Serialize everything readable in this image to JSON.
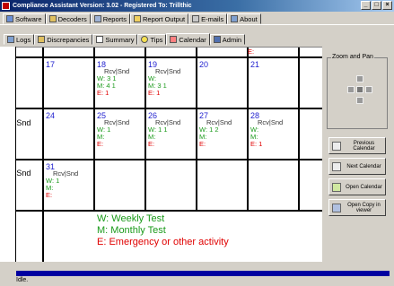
{
  "window": {
    "title": "Compliance Assistant Version: 3.02 - Registered To: Trillthic"
  },
  "menu_tabs": [
    "Software",
    "Decoders",
    "Reports",
    "Report Output",
    "E-mails",
    "About"
  ],
  "sub_tabs": [
    "Logs",
    "Discrepancies",
    "Summary",
    "Tips",
    "Calendar",
    "Admin"
  ],
  "active_sub_tab": "Calendar",
  "calendar": {
    "top_fragment": "E:",
    "left_fragments": [
      "|Snd",
      "|Snd"
    ],
    "days": [
      {
        "day": "17",
        "header": "",
        "w": "",
        "m": "",
        "e": ""
      },
      {
        "day": "18",
        "header": "Rcv|Snd",
        "w": "W:  3   1",
        "m": "M:  4   1",
        "e": "E:          1"
      },
      {
        "day": "19",
        "header": "Rcv|Snd",
        "w": "W:",
        "m": "M:  3   1",
        "e": "E:  1"
      },
      {
        "day": "20",
        "header": "",
        "w": "",
        "m": "",
        "e": ""
      },
      {
        "day": "21",
        "header": "",
        "w": "",
        "m": "",
        "e": ""
      },
      {
        "day": "24",
        "header": "",
        "w": "",
        "m": "",
        "e": ""
      },
      {
        "day": "25",
        "header": "Rcv|Snd",
        "w": "W:  1",
        "m": "M:",
        "e": "E:"
      },
      {
        "day": "26",
        "header": "Rcv|Snd",
        "w": "W:  1   1",
        "m": "M:",
        "e": "E:"
      },
      {
        "day": "27",
        "header": "Rcv|Snd",
        "w": "W:  1   2",
        "m": "M:",
        "e": "E:"
      },
      {
        "day": "28",
        "header": "Rcv|Snd",
        "w": "W:",
        "m": "M:",
        "e": "E:   1"
      },
      {
        "day": "31",
        "header": "Rcv|Snd",
        "w": "W:  1",
        "m": "M:",
        "e": "E:"
      }
    ]
  },
  "legend": {
    "weekly": "W: Weekly Test",
    "monthly": "M: Monthly Test",
    "emergency": "E: Emergency or other activity"
  },
  "zoom_pan": {
    "label": "Zoom and Pan"
  },
  "side_buttons": [
    {
      "label": "Previous Calendar",
      "icon": "calendar-prev-icon"
    },
    {
      "label": "Next Calendar",
      "icon": "calendar-next-icon"
    },
    {
      "label": "Open Calendar",
      "icon": "open-calendar-icon"
    },
    {
      "label": "Open Copy in viewer",
      "icon": "viewer-icon"
    }
  ],
  "status": {
    "text": "Idle."
  },
  "colors": {
    "day_number": "#1f1fcf",
    "weekly": "#1a9a1a",
    "emergency": "#e00000",
    "progress": "#0000a0"
  }
}
